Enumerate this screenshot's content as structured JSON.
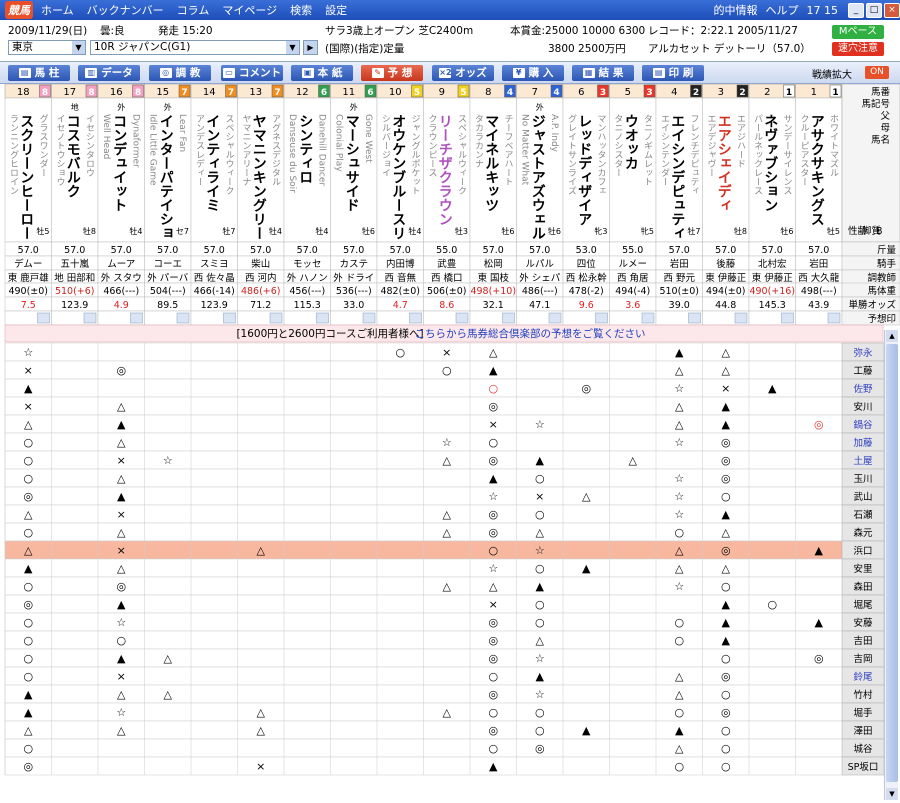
{
  "app": {
    "logo": "競馬",
    "menu": [
      "ホーム",
      "バックナンバー",
      "コラム",
      "マイページ",
      "検索",
      "設定"
    ],
    "right": [
      "的中情報",
      "ヘルプ"
    ],
    "clock": "17 15"
  },
  "race": {
    "date": "2009/11/29(日)",
    "weather": "曇:良",
    "start": "発走 15:20",
    "venue": "東京",
    "race": "10R ジャパンC(G1)",
    "cond1": "サラ3歳上オープン 芝C2400m",
    "cond2": "(国際)(指定)定量",
    "prize": "本賞金:25000 10000 6300",
    "prize2": "3800 2500万円",
    "record": "レコード：2:22.1 2005/11/27",
    "record2": "アルカセット デットーリ（57.0）",
    "mpace": "Mペース",
    "alert": "速穴注意"
  },
  "toolbar": {
    "buttons": [
      "馬 柱",
      "データ",
      "調 教",
      "コメント",
      "本 紙",
      "予 想",
      "オッズ",
      "購 入",
      "結 果",
      "印 刷"
    ],
    "zoom": "戦績拡大",
    "on": "ON"
  },
  "colors": {
    "waku": [
      "#ffffff",
      "#222222",
      "#e8382c",
      "#2f64d8",
      "#f0d020",
      "#30a050",
      "#f08c20",
      "#f4a0c0"
    ]
  },
  "horses": [
    {
      "num": "18",
      "waku": 8,
      "tag": "",
      "sire": "グラスワンダー",
      "name": "スクリーンヒーロー",
      "dam": "ランニングヒロイン",
      "sex": "牡5",
      "wt": "57.0",
      "jockey": "デムー",
      "tstable": "東",
      "trainer": "鹿戸雄",
      "body": "490(±0)",
      "odds": "7.5"
    },
    {
      "num": "17",
      "waku": 8,
      "tag": "地",
      "sire": "イセシンタロウ",
      "name": "コスモバルク",
      "dam": "イセノトウショウ",
      "sex": "牡8",
      "wt": "57.0",
      "jockey": "五十嵐",
      "tstable": "地",
      "trainer": "田部和",
      "body": "510(+6)",
      "odds": "123.9"
    },
    {
      "num": "16",
      "waku": 8,
      "tag": "外",
      "sire": "Dynaformer",
      "name": "コンデュイット",
      "dam": "Well Head",
      "sex": "牡4",
      "wt": "57.0",
      "jockey": "ムーア",
      "tstable": "外",
      "trainer": "スタウ",
      "body": "466(---)",
      "odds": "4.9"
    },
    {
      "num": "15",
      "waku": 7,
      "tag": "外",
      "sire": "Lear Fan",
      "name": "インターパテイショ",
      "dam": "Idle Little Game",
      "sex": "セ7",
      "wt": "57.0",
      "jockey": "コーエ",
      "tstable": "外",
      "trainer": "パーバ",
      "body": "504(---)",
      "odds": "89.5"
    },
    {
      "num": "14",
      "waku": 7,
      "tag": "",
      "sire": "スペシャルウィーク",
      "name": "インティライミ",
      "dam": "アンデスレディー",
      "sex": "牡7",
      "wt": "57.0",
      "jockey": "スミヨ",
      "tstable": "西",
      "trainer": "佐々晶",
      "body": "466(-14)",
      "odds": "123.9"
    },
    {
      "num": "13",
      "waku": 7,
      "tag": "",
      "sire": "アグネスデジタル",
      "name": "ヤマニンキングリー",
      "dam": "ヤマニンアリーナ",
      "sex": "牡4",
      "wt": "57.0",
      "jockey": "柴山",
      "tstable": "西",
      "trainer": "河内",
      "body": "486(+6)",
      "odds": "71.2"
    },
    {
      "num": "12",
      "waku": 6,
      "tag": "",
      "sire": "Danehill Dancer",
      "name": "シンティロ",
      "dam": "Danseuse du Soir",
      "sex": "牡4",
      "wt": "57.0",
      "jockey": "モッセ",
      "tstable": "外",
      "trainer": "ハノン",
      "body": "456(---)",
      "odds": "115.3"
    },
    {
      "num": "11",
      "waku": 6,
      "tag": "外",
      "sire": "Gone West",
      "name": "マーシュサイド",
      "dam": "Colonial Play",
      "sex": "牡6",
      "wt": "57.0",
      "jockey": "カステ",
      "tstable": "外",
      "trainer": "ドライ",
      "body": "536(---)",
      "odds": "33.0"
    },
    {
      "num": "10",
      "waku": 5,
      "tag": "",
      "sire": "ジャングルポケット",
      "name": "オウケンブルースリ",
      "dam": "シルバージョイ",
      "sex": "牡4",
      "wt": "57.0",
      "jockey": "内田博",
      "tstable": "西",
      "trainer": "音無",
      "body": "482(±0)",
      "odds": "4.7"
    },
    {
      "num": "9",
      "waku": 5,
      "tag": "",
      "sire": "スペシャルウィーク",
      "name": "リーチザクラウン",
      "dam": "クラウンピース",
      "sex": "牡3",
      "wt": "55.0",
      "jockey": "武豊",
      "tstable": "西",
      "trainer": "橋口",
      "body": "506(±0)",
      "odds": "8.6"
    },
    {
      "num": "8",
      "waku": 4,
      "tag": "",
      "sire": "チーフベアハート",
      "name": "マイネルキッツ",
      "dam": "タカラカンナ",
      "sex": "牡6",
      "wt": "57.0",
      "jockey": "松岡",
      "tstable": "東",
      "trainer": "国枝",
      "body": "498(+10)",
      "odds": "32.1"
    },
    {
      "num": "7",
      "waku": 4,
      "tag": "外",
      "sire": "A.P. Indy",
      "name": "ジャストアズウェル",
      "dam": "No Matter What",
      "sex": "牡6",
      "wt": "57.0",
      "jockey": "ルパル",
      "tstable": "外",
      "trainer": "シェパ",
      "body": "486(---)",
      "odds": "47.1"
    },
    {
      "num": "6",
      "waku": 3,
      "tag": "",
      "sire": "マンハッタンカフェ",
      "name": "レッドディザイア",
      "dam": "グレイトサンライズ",
      "sex": "牝3",
      "wt": "53.0",
      "jockey": "四位",
      "tstable": "西",
      "trainer": "松永幹",
      "body": "478(-2)",
      "odds": "9.6"
    },
    {
      "num": "5",
      "waku": 3,
      "tag": "",
      "sire": "タニノギムレット",
      "name": "ウオッカ",
      "dam": "タニノシスター",
      "sex": "牝5",
      "wt": "55.0",
      "jockey": "ルメー",
      "tstable": "西",
      "trainer": "角居",
      "body": "494(-4)",
      "odds": "3.6"
    },
    {
      "num": "4",
      "waku": 2,
      "tag": "",
      "sire": "フレンチデピュティ",
      "name": "エイシンデピュティ",
      "dam": "エイシンテンダー",
      "sex": "牡7",
      "wt": "57.0",
      "jockey": "岩田",
      "tstable": "西",
      "trainer": "野元",
      "body": "510(±0)",
      "odds": "39.0"
    },
    {
      "num": "3",
      "waku": 2,
      "tag": "",
      "sire": "エアジハード",
      "name": "エアシェイディ",
      "dam": "エアデジャヴー",
      "sex": "牡8",
      "wt": "57.0",
      "jockey": "後藤",
      "tstable": "東",
      "trainer": "伊藤正",
      "body": "494(±0)",
      "odds": "44.8"
    },
    {
      "num": "2",
      "waku": 1,
      "tag": "",
      "sire": "サンデーサイレンス",
      "name": "ネヴァブション",
      "dam": "パールネックレース",
      "sex": "牡6",
      "wt": "57.0",
      "jockey": "北村宏",
      "tstable": "東",
      "trainer": "伊藤正",
      "body": "490(+16)",
      "odds": "145.3"
    },
    {
      "num": "1",
      "waku": 1,
      "tag": "",
      "sire": "ホワイトマズル",
      "name": "アサクサキングス",
      "dam": "クルーピアスター",
      "sex": "牡5",
      "wt": "57.0",
      "jockey": "岩田",
      "tstable": "西",
      "trainer": "大久龍",
      "body": "498(---)",
      "odds": "43.9"
    }
  ],
  "labels": {
    "top": [
      "馬番",
      "馬記号",
      "父",
      "母",
      "馬名"
    ],
    "aside": [
      "性齢",
      "脚質",
      "B"
    ],
    "rows": [
      "斤量",
      "騎手",
      "調教師",
      "馬体重",
      "単勝オッズ",
      "予想印"
    ]
  },
  "banner": {
    "text": "[1600円と2600円コースご利用者様へ]",
    "link": "こちらから馬券総合倶楽部の予想をご覧ください"
  },
  "pickers": [
    {
      "name": "弥永",
      "m": [
        "☆",
        "",
        "",
        "",
        "",
        "",
        "",
        "",
        "○",
        "×",
        "△",
        "",
        "",
        "",
        "▲",
        "△",
        "",
        ""
      ]
    },
    {
      "name": "工藤",
      "m": [
        "×",
        "",
        "◎",
        "",
        "",
        "",
        "",
        "",
        "",
        "○",
        "▲",
        "",
        "",
        "",
        "△",
        "△",
        "",
        ""
      ]
    },
    {
      "name": "佐野",
      "m": [
        "▲",
        "",
        "",
        "",
        "",
        "",
        "",
        "",
        "",
        "",
        "○",
        "",
        "◎",
        "",
        "☆",
        "×",
        "▲",
        "",
        "",
        "△"
      ]
    },
    {
      "name": "安川",
      "m": [
        "×",
        "",
        "△",
        "",
        "",
        "",
        "",
        "",
        "",
        "",
        "◎",
        "",
        "",
        "",
        "△",
        "▲",
        "",
        ""
      ]
    },
    {
      "name": "鍋谷",
      "m": [
        "△",
        "",
        "▲",
        "",
        "",
        "",
        "",
        "",
        "",
        "",
        "×",
        "☆",
        "",
        "",
        "△",
        "▲",
        "",
        "◎"
      ]
    },
    {
      "name": "加藤",
      "m": [
        "○",
        "",
        "△",
        "",
        "",
        "",
        "",
        "",
        "",
        "☆",
        "○",
        "",
        "",
        "",
        "☆",
        "◎",
        "",
        ""
      ]
    },
    {
      "name": "土屋",
      "m": [
        "○",
        "",
        "×",
        "☆",
        "",
        "",
        "",
        "",
        "",
        "△",
        "◎",
        "▲",
        "",
        "△",
        "",
        "◎",
        "",
        ""
      ]
    },
    {
      "name": "玉川",
      "m": [
        "○",
        "",
        "△",
        "",
        "",
        "",
        "",
        "",
        "",
        "",
        "▲",
        "○",
        "",
        "",
        "☆",
        "◎",
        "",
        ""
      ]
    },
    {
      "name": "武山",
      "m": [
        "◎",
        "",
        "▲",
        "",
        "",
        "",
        "",
        "",
        "",
        "",
        "☆",
        "×",
        "△",
        "",
        "☆",
        "○",
        "",
        ""
      ]
    },
    {
      "name": "石瀬",
      "m": [
        "△",
        "",
        "×",
        "",
        "",
        "",
        "",
        "",
        "",
        "△",
        "◎",
        "○",
        "",
        "",
        "☆",
        "▲",
        "",
        ""
      ]
    },
    {
      "name": "森元",
      "m": [
        "○",
        "",
        "△",
        "",
        "",
        "",
        "",
        "",
        "",
        "△",
        "◎",
        "△",
        "",
        "",
        "○",
        "△",
        "",
        ""
      ]
    },
    {
      "name": "浜口",
      "m": [
        "△",
        "",
        "×",
        "",
        "",
        "△",
        "",
        "",
        "",
        "",
        "○",
        "☆",
        "",
        "",
        "△",
        "◎",
        "",
        "▲"
      ]
    },
    {
      "name": "安里",
      "m": [
        "▲",
        "",
        "△",
        "",
        "",
        "",
        "",
        "",
        "",
        "",
        "☆",
        "○",
        "▲",
        "",
        "△",
        "△",
        "",
        ""
      ]
    },
    {
      "name": "森田",
      "m": [
        "○",
        "",
        "◎",
        "",
        "",
        "",
        "",
        "",
        "",
        "△",
        "△",
        "▲",
        "",
        "",
        "☆",
        "○",
        "",
        ""
      ]
    },
    {
      "name": "堀尾",
      "m": [
        "◎",
        "",
        "▲",
        "",
        "",
        "",
        "",
        "",
        "",
        "",
        "×",
        "○",
        "",
        "",
        "",
        "▲",
        "○",
        "",
        "",
        "☆"
      ]
    },
    {
      "name": "安藤",
      "m": [
        "○",
        "",
        "☆",
        "",
        "",
        "",
        "",
        "",
        "",
        "",
        "◎",
        "○",
        "",
        "",
        "○",
        "▲",
        "",
        "▲"
      ]
    },
    {
      "name": "吉田",
      "m": [
        "○",
        "",
        "○",
        "",
        "",
        "",
        "",
        "",
        "",
        "",
        "◎",
        "△",
        "",
        "",
        "○",
        "▲",
        "",
        ""
      ]
    },
    {
      "name": "吉岡",
      "m": [
        "○",
        "",
        "▲",
        "△",
        "",
        "",
        "",
        "",
        "",
        "",
        "◎",
        "☆",
        "",
        "",
        "",
        "○",
        "",
        "◎"
      ]
    },
    {
      "name": "鈴尾",
      "m": [
        "○",
        "",
        "×",
        "",
        "",
        "",
        "",
        "",
        "",
        "",
        "○",
        "▲",
        "",
        "",
        "△",
        "◎",
        "",
        ""
      ]
    },
    {
      "name": "竹村",
      "m": [
        "▲",
        "",
        "△",
        "△",
        "",
        "",
        "",
        "",
        "",
        "",
        "◎",
        "☆",
        "",
        "",
        "△",
        "○",
        "",
        ""
      ]
    },
    {
      "name": "堀手",
      "m": [
        "▲",
        "",
        "☆",
        "",
        "",
        "△",
        "",
        "",
        "",
        "△",
        "○",
        "○",
        "",
        "",
        "○",
        "◎",
        "",
        ""
      ]
    },
    {
      "name": "澤田",
      "m": [
        "△",
        "",
        "△",
        "",
        "",
        "△",
        "",
        "",
        "",
        "",
        "◎",
        "○",
        "▲",
        "",
        "▲",
        "○",
        "",
        ""
      ]
    },
    {
      "name": "城谷",
      "m": [
        "○",
        "",
        "",
        "",
        "",
        "",
        "",
        "",
        "",
        "",
        "○",
        "◎",
        "",
        "",
        "△",
        "○",
        "",
        ""
      ]
    },
    {
      "name": "SP坂口",
      "m": [
        "◎",
        "",
        "",
        "",
        "",
        "×",
        "",
        "",
        "",
        "",
        "▲",
        "",
        "",
        "",
        "○",
        "○",
        "",
        ""
      ]
    }
  ]
}
